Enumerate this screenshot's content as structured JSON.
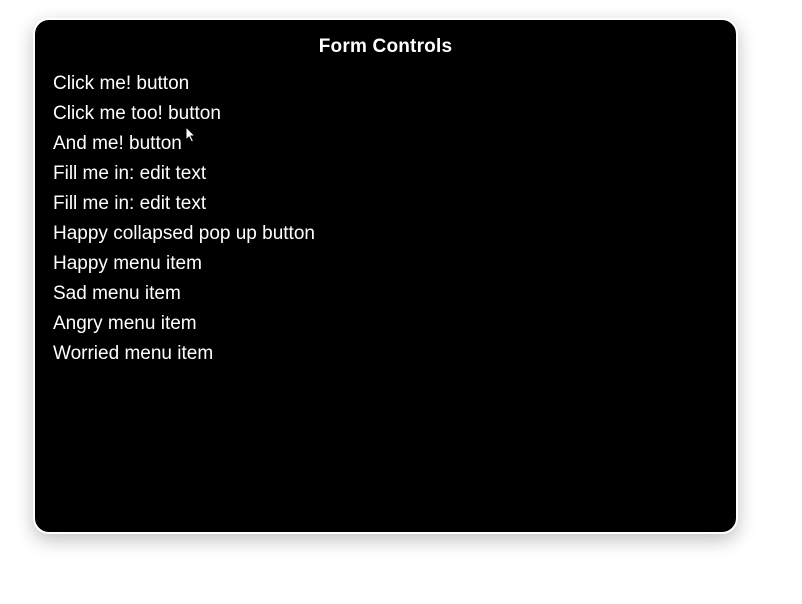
{
  "title": "Form Controls",
  "items": [
    {
      "label": "Click me! button"
    },
    {
      "label": "Click me too! button"
    },
    {
      "label": "And me! button"
    },
    {
      "label": "Fill me in: edit text"
    },
    {
      "label": "Fill me in: edit text"
    },
    {
      "label": "Happy collapsed pop up button"
    },
    {
      "label": "Happy menu item"
    },
    {
      "label": "Sad menu item"
    },
    {
      "label": "Angry menu item"
    },
    {
      "label": "Worried menu item"
    }
  ]
}
